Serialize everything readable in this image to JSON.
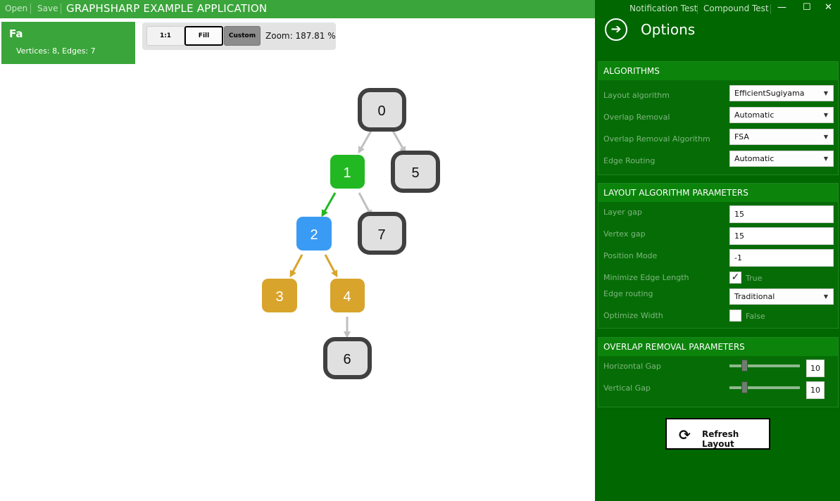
{
  "titlebar": {
    "open_label": "Open",
    "save_label": "Save",
    "app_title": "GRAPHSHARP EXAMPLE APPLICATION"
  },
  "info_card": {
    "name": "Fa",
    "stats": "Vertices: 8, Edges: 7"
  },
  "zoom": {
    "one_to_one_label": "1:1",
    "fill_label": "Fill",
    "custom_label": "Custom",
    "zoom_text": "Zoom: 187.81 %"
  },
  "graph": {
    "vertices": [
      "0",
      "1",
      "2",
      "3",
      "4",
      "5",
      "6",
      "7"
    ],
    "edges": [
      [
        "0",
        "1"
      ],
      [
        "0",
        "5"
      ],
      [
        "1",
        "2"
      ],
      [
        "1",
        "7"
      ],
      [
        "2",
        "3"
      ],
      [
        "2",
        "4"
      ],
      [
        "4",
        "6"
      ]
    ],
    "colors": {
      "default_fill": "#e0e0e0",
      "default_border": "#404040",
      "selected": "#22b822",
      "highlight": "#3a9bf5",
      "related": "#d8a42c",
      "edge_default": "#c0c0c0",
      "edge_green": "#22b822",
      "edge_gold": "#d8a42c"
    }
  },
  "panel": {
    "notification_label": "Notification Test",
    "compound_label": "Compound Test",
    "minimize_label": "—",
    "maximize_label": "☐",
    "close_label": "✕",
    "back_icon": "➔",
    "title": "Options",
    "algorithms": {
      "header": "ALGORITHMS",
      "layout_algorithm_label": "Layout algorithm",
      "layout_algorithm_value": "EfficientSugiyama",
      "overlap_removal_label": "Overlap Removal",
      "overlap_removal_value": "Automatic",
      "overlap_removal_algorithm_label": "Overlap Removal Algorithm",
      "overlap_removal_algorithm_value": "FSA",
      "edge_routing_label": "Edge Routing",
      "edge_routing_value": "Automatic"
    },
    "layout_params": {
      "header": "LAYOUT ALGORITHM PARAMETERS",
      "layer_gap_label": "Layer gap",
      "layer_gap_value": "15",
      "vertex_gap_label": "Vertex gap",
      "vertex_gap_value": "15",
      "position_mode_label": "Position Mode",
      "position_mode_value": "-1",
      "minimize_edge_length_label": "Minimize Edge Length",
      "minimize_edge_length_value": "True",
      "edge_routing_label": "Edge routing",
      "edge_routing_value": "Traditional",
      "optimize_width_label": "Optimize Width",
      "optimize_width_value": "False"
    },
    "overlap_params": {
      "header": "OVERLAP REMOVAL PARAMETERS",
      "horizontal_gap_label": "Horizontal Gap",
      "horizontal_gap_value": "10",
      "vertical_gap_label": "Vertical Gap",
      "vertical_gap_value": "10"
    },
    "refresh_label": "Refresh Layout",
    "refresh_icon": "⟳"
  }
}
